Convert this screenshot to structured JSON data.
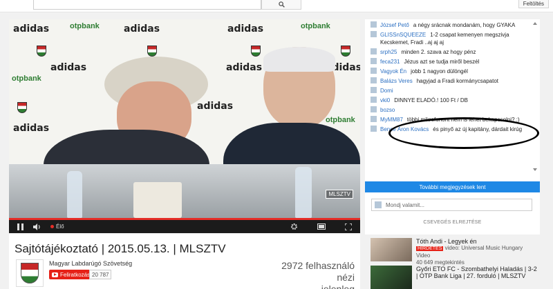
{
  "masthead": {
    "search_placeholder": "",
    "upload_label": "Feltöltés"
  },
  "player": {
    "live_label": "Élő",
    "watermark": "MLSZTV",
    "sponsors": {
      "adidas": "adidas",
      "otp": "otpbank"
    },
    "progress_fraction": 1.0
  },
  "video": {
    "title": "Sajtótájékoztató | 2015.05.13. | MLSZTV",
    "channel": "Magyar Labdarúgó Szövetség",
    "subscribe_label": "Feliratkozás",
    "subscriber_count": "20 787",
    "viewers_line1": "2972 felhasználó nézi",
    "viewers_line2": "jelenleg"
  },
  "chat": {
    "messages": [
      {
        "author": "József Pető",
        "text": "a négy srácnak mondanám, hogy GYAKA"
      },
      {
        "author": "GLISSnSQUEEZE",
        "text": "1-2 csapat kemenyen megszivja Kecskemet, Fradi ..aj aj aj"
      },
      {
        "author": "srph25",
        "text": "minden 2. szava az hogy pénz"
      },
      {
        "author": "feca231",
        "text": "Jézus azt se tudja miről beszél"
      },
      {
        "author": "Vagyok Én",
        "text": "jobb 1 nagyon dülöngél"
      },
      {
        "author": "Balázs Veres",
        "text": "hagyjad a Fradi kormánycsapatot"
      },
      {
        "author": "Domi",
        "text": ""
      },
      {
        "author": "vki0",
        "text": "DINNYE ELADÓ.! 100 Ft / DB"
      },
      {
        "author": "bozso",
        "text": ""
      },
      {
        "author": "MyMM87",
        "text": "többi mikrofonont nem is lehet bekapcsolni? :)"
      },
      {
        "author": "Bence Áron Kovács",
        "text": "és pinyő az új kapitány, dárdait kirúg"
      }
    ],
    "more_comments_label": "További megjegyzések lent",
    "input_placeholder": "Mondj valamit...",
    "hide_chat_label": "CSEVEGÉS ELREJTÉSE"
  },
  "recommended": [
    {
      "title": "Tóth Andi - Legyek én",
      "badge": "HIRDETÉS",
      "uploader": "video: Universal Music Hungary Video",
      "views": "40 649 megtekintés",
      "duration": ""
    },
    {
      "title": "Győri ETO FC - Szombathelyi Haladás | 3-2 | OTP Bank Liga | 27. forduló | MLSZTV",
      "badge": "",
      "uploader": "",
      "views": "",
      "duration": ""
    }
  ]
}
